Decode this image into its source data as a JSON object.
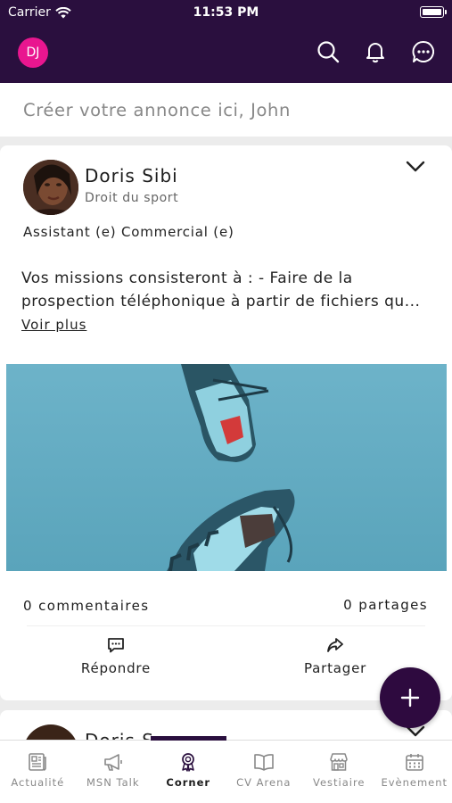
{
  "status_bar": {
    "carrier": "Carrier",
    "time": "11:53 PM"
  },
  "header": {
    "avatar_initials": "DJ",
    "icons": [
      "search-icon",
      "bell-icon",
      "chat-icon"
    ],
    "bg_color": "#2a0f3e",
    "avatar_color": "#e9168f"
  },
  "composer": {
    "placeholder": "Créer votre annonce ici, John"
  },
  "post": {
    "author": "Doris Sibi",
    "subtitle": "Droit du sport",
    "role": "Assistant (e) Commercial (e)",
    "body": "Vos missions consisteront à : - Faire de la prospection téléphonique à partir de fichiers qu...",
    "more": "Voir plus",
    "comments": "0 commentaires",
    "shares": "0 partages",
    "reply_label": "Répondre",
    "share_label": "Partager"
  },
  "post2": {
    "author": "Doris S"
  },
  "tabs": [
    {
      "label": "Actualité",
      "icon": "newspaper-icon"
    },
    {
      "label": "MSN Talk",
      "icon": "megaphone-icon"
    },
    {
      "label": "Corner",
      "icon": "award-icon",
      "active": true
    },
    {
      "label": "CV Arena",
      "icon": "book-icon"
    },
    {
      "label": "Vestiaire",
      "icon": "store-icon"
    },
    {
      "label": "Evènement",
      "icon": "calendar-icon"
    }
  ]
}
